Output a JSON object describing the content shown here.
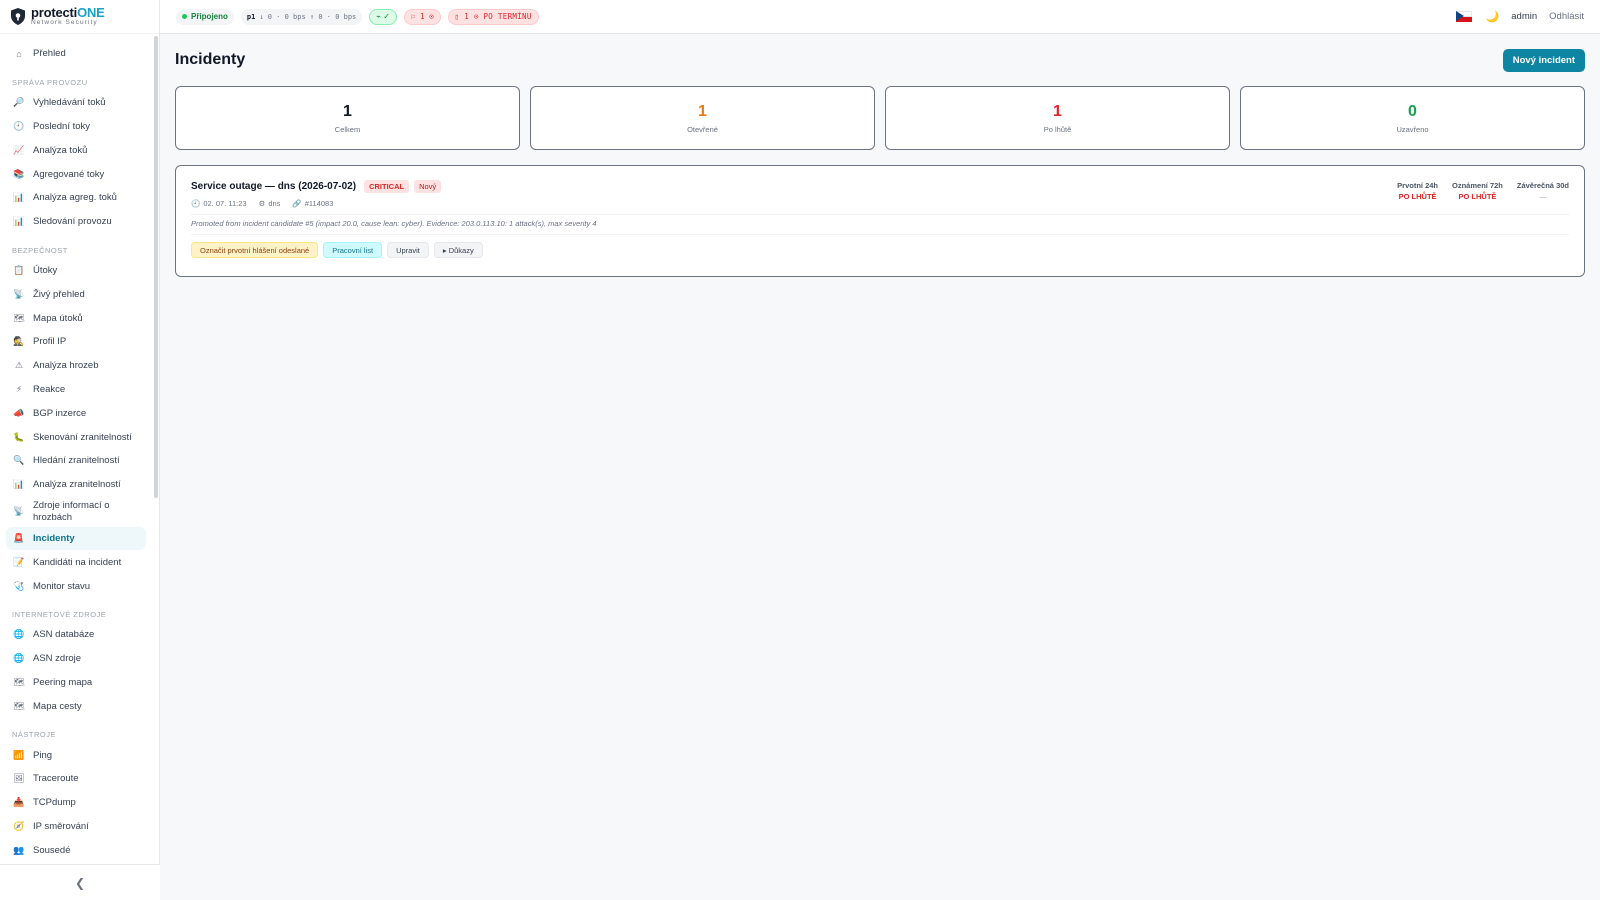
{
  "brand": {
    "name_main": "protecti",
    "name_accent": "ONE",
    "subtitle": "Network Security"
  },
  "topbar": {
    "status": "Připojeno",
    "traffic": {
      "probe": "p1",
      "down": "↓ 0 · 0 bps",
      "up": "↑ 0 · 0 bps"
    },
    "health": "⌁ ✓",
    "flags": "⚐ 1 ⊙",
    "overdue": "▯ 1 ⊙ PO TERMÍNU",
    "user": "admin",
    "logout": "Odhlásit"
  },
  "sidebar": {
    "overview": "Přehled",
    "sections": [
      {
        "title": "Správa provozu",
        "items": [
          {
            "icon": "🔎",
            "label": "Vyhledávání toků"
          },
          {
            "icon": "🕘",
            "label": "Poslední toky"
          },
          {
            "icon": "📈",
            "label": "Analýza toků"
          },
          {
            "icon": "📚",
            "label": "Agregované toky"
          },
          {
            "icon": "📊",
            "label": "Analýza agreg. toků"
          },
          {
            "icon": "📊",
            "label": "Sledování provozu"
          }
        ]
      },
      {
        "title": "Bezpečnost",
        "items": [
          {
            "icon": "📋",
            "label": "Útoky"
          },
          {
            "icon": "📡",
            "label": "Živý přehled"
          },
          {
            "icon": "🗺",
            "label": "Mapa útoků"
          },
          {
            "icon": "🕵",
            "label": "Profil IP"
          },
          {
            "icon": "⚠",
            "label": "Analýza hrozeb"
          },
          {
            "icon": "⚡",
            "label": "Reakce"
          },
          {
            "icon": "📣",
            "label": "BGP inzerce"
          },
          {
            "icon": "🐛",
            "label": "Skenování zranitelností"
          },
          {
            "icon": "🔍",
            "label": "Hledání zranitelností"
          },
          {
            "icon": "📊",
            "label": "Analýza zranitelností"
          },
          {
            "icon": "📡",
            "label": "Zdroje informací o hrozbách"
          },
          {
            "icon": "🚨",
            "label": "Incidenty"
          },
          {
            "icon": "📝",
            "label": "Kandidáti na incident"
          },
          {
            "icon": "🩺",
            "label": "Monitor stavu"
          }
        ]
      },
      {
        "title": "Internetové zdroje",
        "items": [
          {
            "icon": "🌐",
            "label": "ASN databáze"
          },
          {
            "icon": "🌐",
            "label": "ASN zdroje"
          },
          {
            "icon": "🗺",
            "label": "Peering mapa"
          },
          {
            "icon": "🗺",
            "label": "Mapa cesty"
          }
        ]
      },
      {
        "title": "Nástroje",
        "items": [
          {
            "icon": "📶",
            "label": "Ping"
          },
          {
            "icon": "🖼",
            "label": "Traceroute"
          },
          {
            "icon": "📥",
            "label": "TCPdump"
          },
          {
            "icon": "🧭",
            "label": "IP směrování"
          },
          {
            "icon": "👥",
            "label": "Sousedé"
          }
        ]
      }
    ],
    "collapse": "❮"
  },
  "page": {
    "title": "Incidenty",
    "new_button": "Nový incident",
    "stats": [
      {
        "value": "1",
        "label": "Celkem",
        "color": "#111827"
      },
      {
        "value": "1",
        "label": "Otevřené",
        "color": "#ea7a0c"
      },
      {
        "value": "1",
        "label": "Po lhůtě",
        "color": "#dc2626"
      },
      {
        "value": "0",
        "label": "Uzavřeno",
        "color": "#16a34a"
      }
    ],
    "incident": {
      "title": "Service outage — dns (2026-07-02)",
      "severity": "CRITICAL",
      "status": "Nový",
      "time": "02. 07. 11:23",
      "service": "dns",
      "ref": "#114083",
      "description": "Promoted from incident candidate #5 (impact 20.0, cause lean: cyber). Evidence: 203.0.113.10: 1 attack(s), max severity 4",
      "actions": [
        "Označit prvotní hlášení odeslané",
        "Pracovní list",
        "Upravit",
        "▸ Důkazy"
      ],
      "deadlines": [
        {
          "label": "Prvotní 24h",
          "value": "PO LHŮTĚ"
        },
        {
          "label": "Oznámení 72h",
          "value": "PO LHŮTĚ"
        },
        {
          "label": "Závěrečná 30d",
          "value": "—"
        }
      ]
    }
  }
}
